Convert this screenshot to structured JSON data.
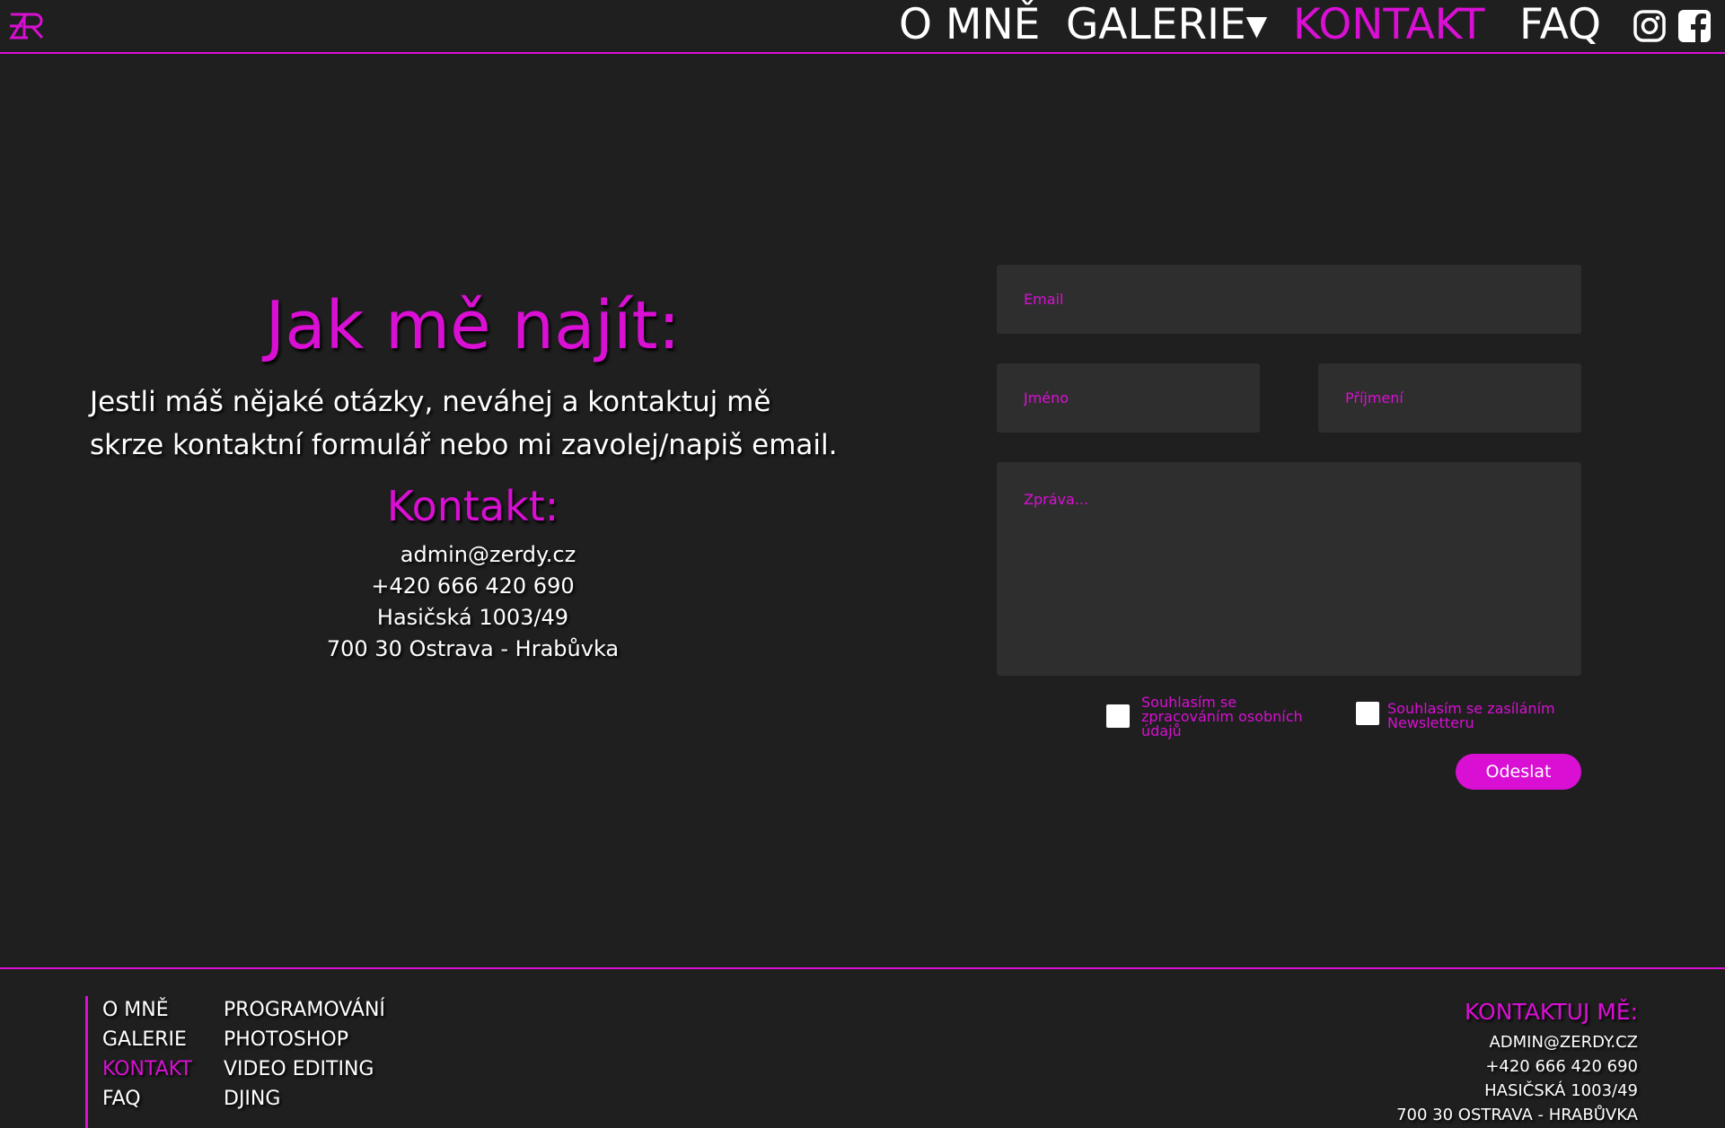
{
  "nav": {
    "logo": "ZR",
    "items": [
      {
        "label": "O MNĚ",
        "active": false
      },
      {
        "label": "GALERIE▾",
        "active": false
      },
      {
        "label": "KONTAKT",
        "active": true
      },
      {
        "label": "FAQ",
        "active": false
      }
    ],
    "icons": [
      "instagram-icon",
      "facebook-icon"
    ]
  },
  "main": {
    "heading": "Jak mě najít:",
    "intro_line1": "Jestli máš nějaké otázky, neváhej a kontaktuj mě",
    "intro_line2": "skrze kontaktní formulář nebo mi zavolej/napiš email.",
    "contact_title": "Kontakt:",
    "contact": {
      "email": "admin@zerdy.cz",
      "phone": "+420 666 420 690",
      "street": "Hasičská 1003/49",
      "city": "700 30 Ostrava - Hrabůvka"
    }
  },
  "form": {
    "email_placeholder": "Email",
    "first_name_placeholder": "Jméno",
    "last_name_placeholder": "Příjmení",
    "message_placeholder": "Zpráva...",
    "consent_line1": "Souhlasím se",
    "consent_line2": "zpracováním osobních",
    "consent_line3": "údajů",
    "newsletter_line1": "Souhlasím se zasíláním",
    "newsletter_line2": "Newsletteru",
    "submit_label": "Odeslat"
  },
  "footer": {
    "nav_col1": [
      "O MNĚ",
      "GALERIE",
      "KONTAKT",
      "FAQ"
    ],
    "nav_col2": [
      "PROGRAMOVÁNÍ",
      "PHOTOSHOP",
      "VIDEO EDITING",
      "DJING"
    ],
    "contact_title": "KONTAKTUJ MĚ:",
    "contact_email": "ADMIN@ZERDY.CZ",
    "contact_phone": "+420 666 420 690",
    "contact_street": "HASIČSKÁ 1003/49",
    "contact_city": "700 30 OSTRAVA - HRABŮVKA"
  },
  "colors": {
    "accent": "#d90fd3",
    "background": "#1f1f1f",
    "field": "#2e2e2e"
  }
}
